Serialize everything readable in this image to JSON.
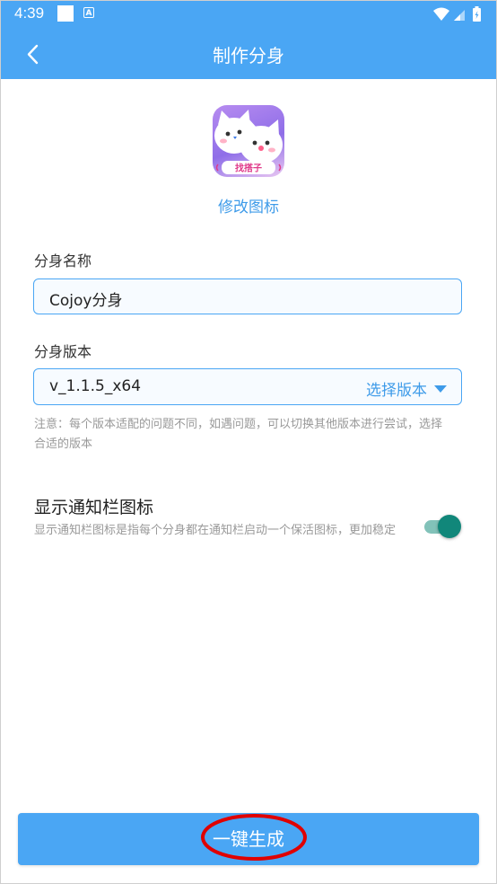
{
  "status_bar": {
    "time": "4:39",
    "notification_icon": "A"
  },
  "header": {
    "title": "制作分身",
    "back_icon": "chevron-left-icon"
  },
  "app": {
    "icon_text": "找搭子",
    "change_icon_label": "修改图标"
  },
  "name_field": {
    "label": "分身名称",
    "value": "Cojoy分身"
  },
  "version_field": {
    "label": "分身版本",
    "value": "v_1.1.5_x64",
    "select_label": "选择版本",
    "note": "注意：每个版本适配的问题不同，如遇问题，可以切换其他版本进行尝试，选择合适的版本"
  },
  "notification_toggle": {
    "title": "显示通知栏图标",
    "description": "显示通知栏图标是指每个分身都在通知栏启动一个保活图标，更加稳定",
    "enabled": true
  },
  "generate_button": {
    "label": "一键生成"
  },
  "colors": {
    "primary": "#4aa6f4",
    "accent_text": "#3e9be9",
    "toggle_on": "#11877a",
    "annotation": "#e00000"
  }
}
